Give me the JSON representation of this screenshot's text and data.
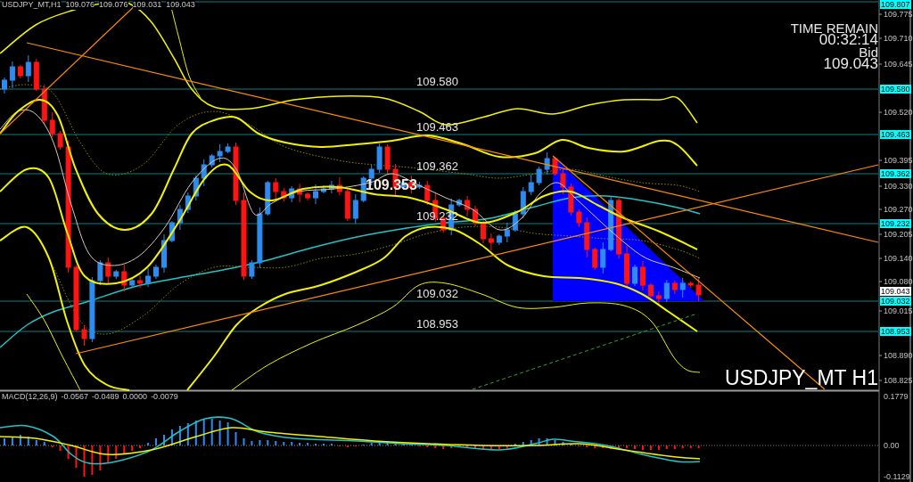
{
  "header": {
    "symbol": "USDJPY_MT,H1",
    "ohlc": [
      "109.076",
      "109.076",
      "109.031",
      "109.043"
    ]
  },
  "price_lines": [
    {
      "axis_tag": "109.807"
    },
    {
      "axis_tag": "109.580",
      "chart_label": "109.580"
    },
    {
      "axis_tag": "109.463",
      "chart_label": "109.463"
    },
    {
      "axis_tag": "109.362",
      "chart_label": "109.362"
    },
    {
      "axis_tag": "109.232",
      "chart_label": "109.232"
    },
    {
      "axis_tag": "109.032",
      "chart_label": "109.032"
    },
    {
      "axis_tag": "108.953",
      "chart_label": "108.953"
    }
  ],
  "price_marker": "109.353",
  "info_panel": {
    "time_label": "TIME REMAIN",
    "time": "00:32:14",
    "bid_label": "Bid",
    "bid": "109.043"
  },
  "symbol_label": "USDJPY_MT H1",
  "price_axis": {
    "ticks": [
      "109.775",
      "109.710",
      "109.645",
      "109.520",
      "109.395",
      "109.330",
      "109.270",
      "109.205",
      "109.140",
      "109.080",
      "109.015",
      "108.890",
      "108.825"
    ],
    "bid_tag": "109.043"
  },
  "macd": {
    "title": "MACD(12,26,9)",
    "values": [
      "-0.0567",
      "-0.0489",
      "0.0000",
      "-0.0079"
    ],
    "axis_ticks": [
      "0.1779",
      "0.00",
      "-0.1129"
    ]
  }
}
